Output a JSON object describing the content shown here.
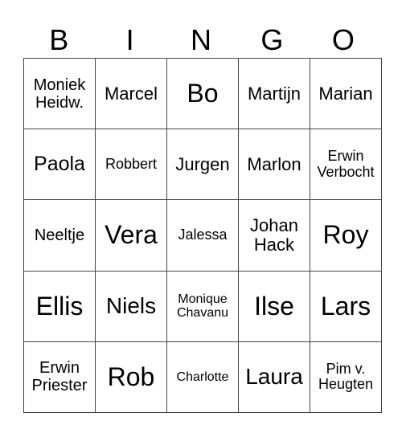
{
  "header": [
    "B",
    "I",
    "N",
    "G",
    "O"
  ],
  "rows": [
    [
      "Moniek\nHeidw.",
      "Marcel",
      "Bo",
      "Martijn",
      "Marian"
    ],
    [
      "Paola",
      "Robbert",
      "Jurgen",
      "Marlon",
      "Erwin\nVerbocht"
    ],
    [
      "Neeltje",
      "Vera",
      "Jalessa",
      "Johan\nHack",
      "Roy"
    ],
    [
      "Ellis",
      "Niels",
      "Monique\nChavanu",
      "Ilse",
      "Lars"
    ],
    [
      "Erwin\nPriester",
      "Rob",
      "Charlotte",
      "Laura",
      "Pim v.\nHeugten"
    ]
  ]
}
